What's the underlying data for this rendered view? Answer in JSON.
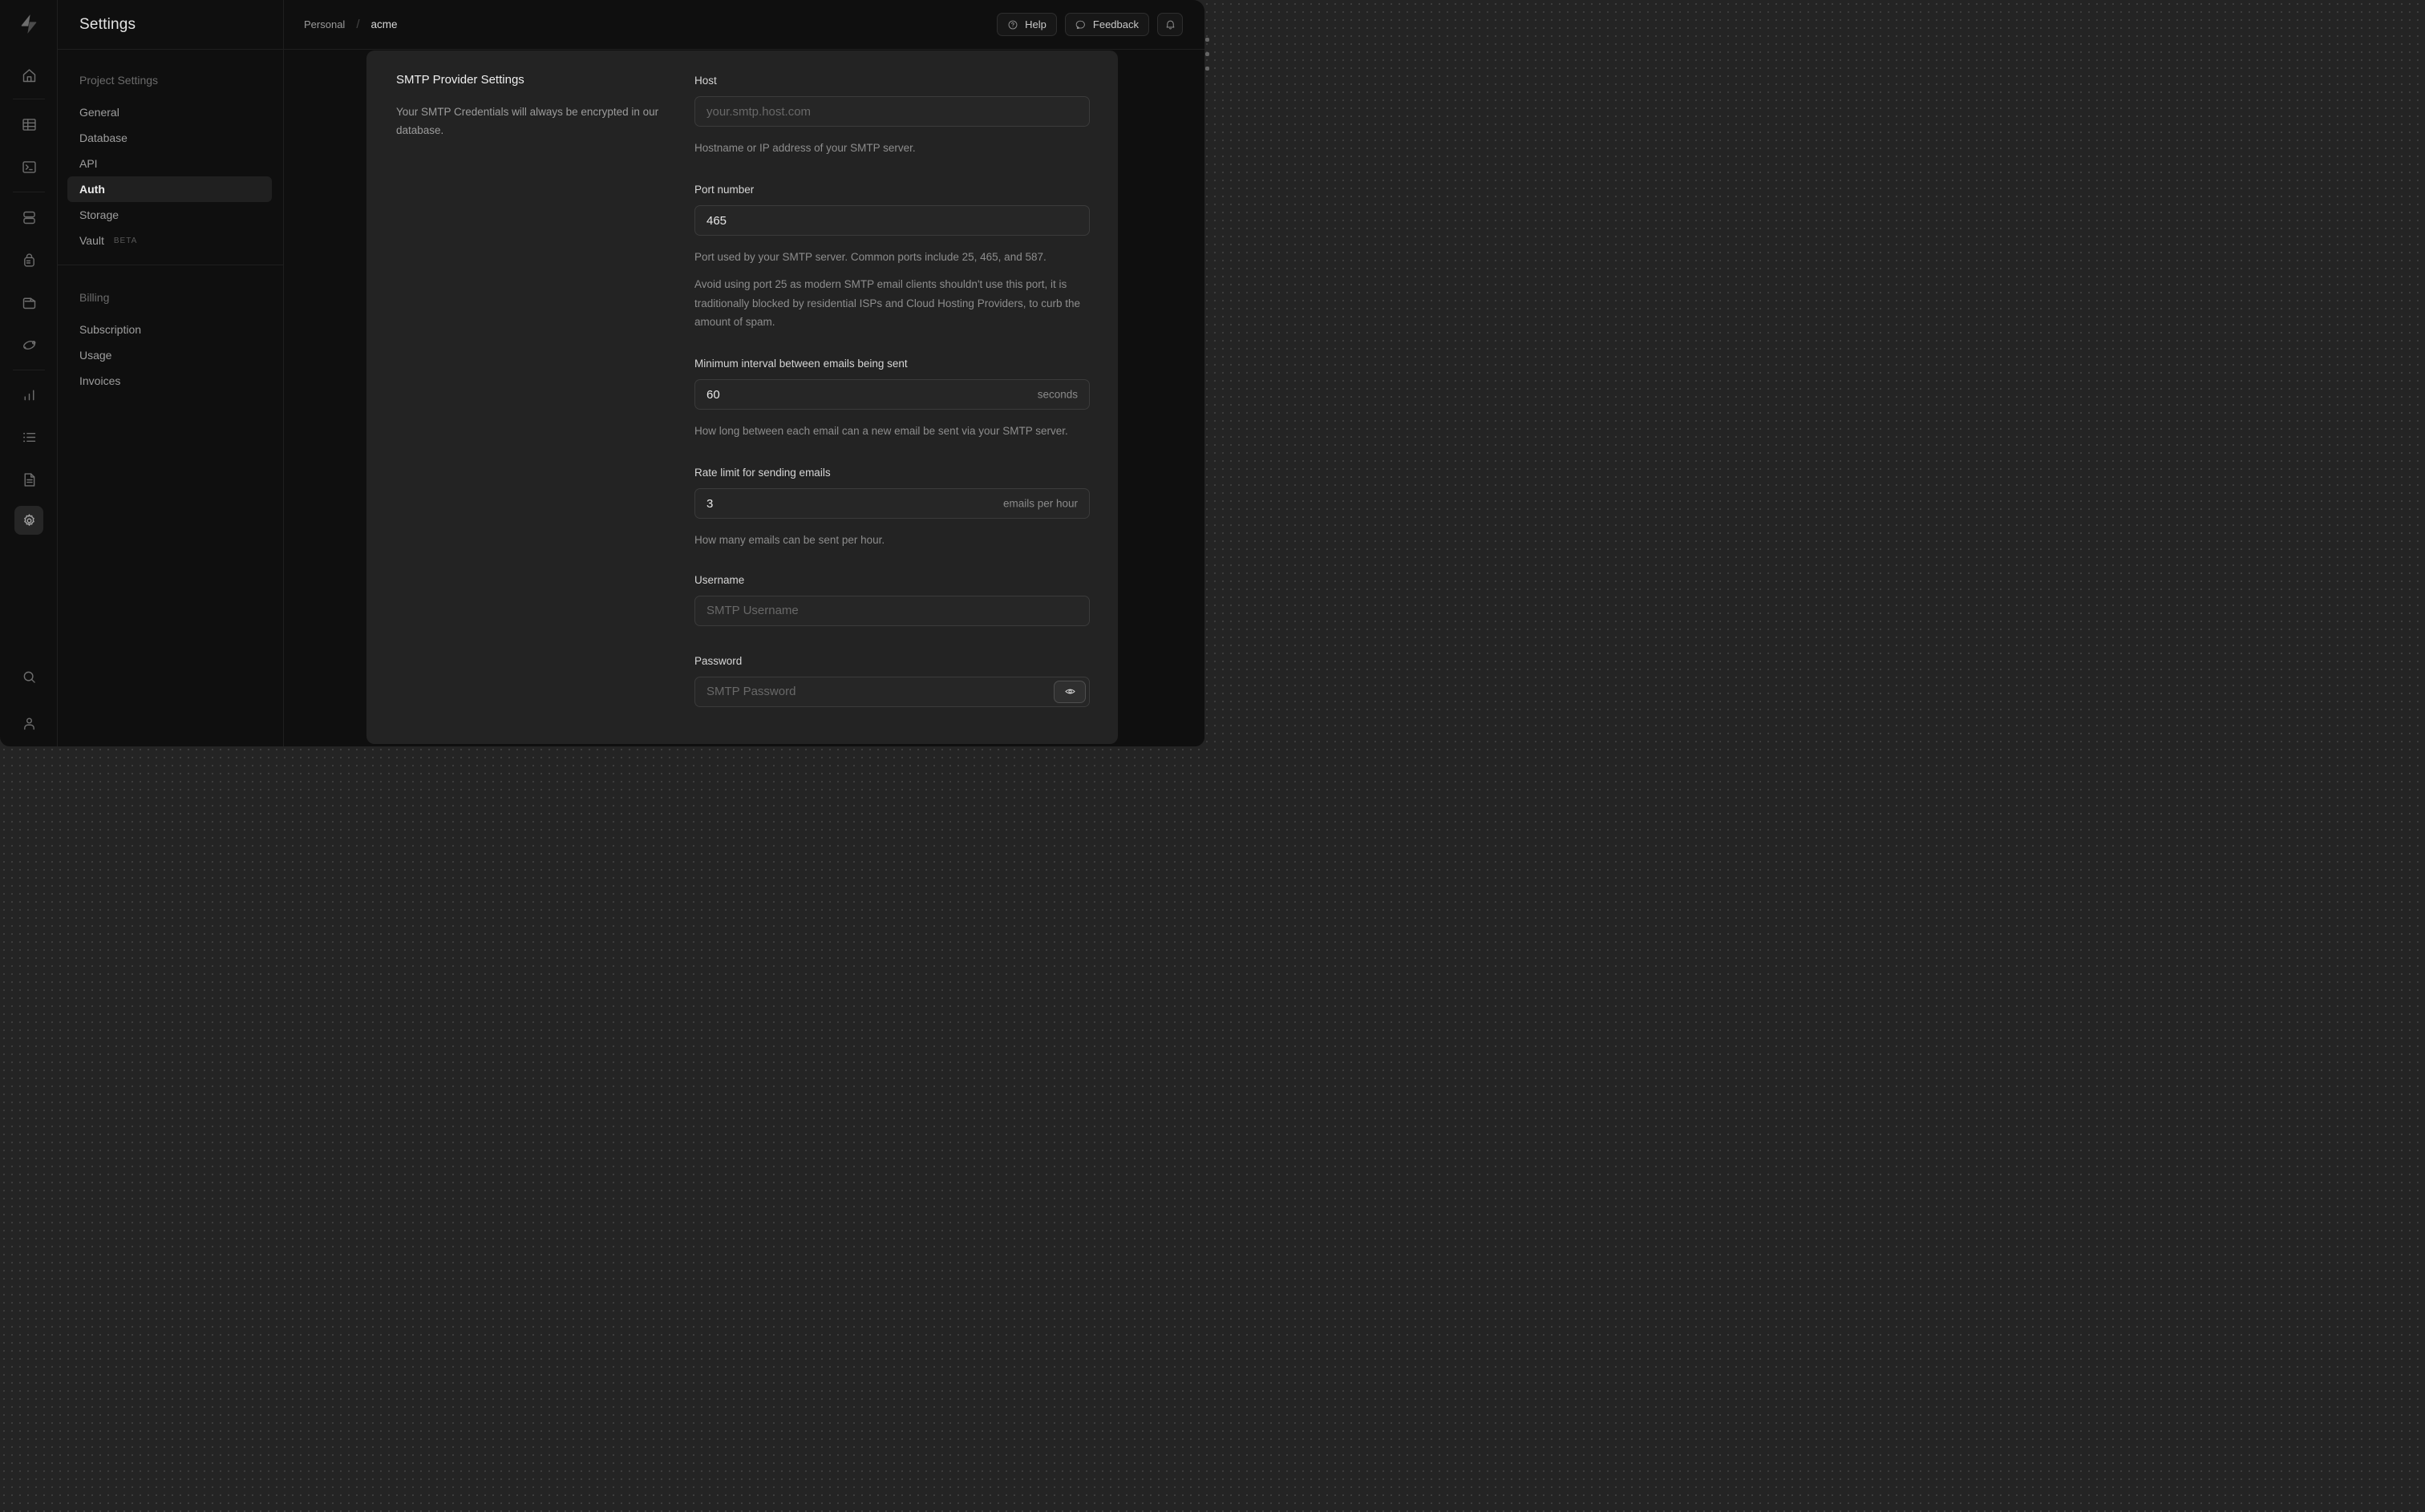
{
  "header": {
    "title": "Settings",
    "breadcrumb": {
      "org": "Personal",
      "separator": "/",
      "project": "acme"
    },
    "actions": {
      "help": "Help",
      "feedback": "Feedback",
      "notifications_icon": "bell-icon"
    }
  },
  "brand": {
    "logo_icon": "supabase-bolt-icon"
  },
  "rail": {
    "icons": [
      "home-icon",
      "table-editor-icon",
      "sql-editor-icon",
      "database-icon",
      "auth-lock-icon",
      "storage-folder-icon",
      "edge-functions-icon",
      "reports-chart-icon",
      "logs-list-icon",
      "docs-file-icon",
      "settings-gear-icon",
      "search-icon",
      "user-icon"
    ],
    "active": "settings-gear-icon"
  },
  "sidebar": {
    "sections": [
      {
        "heading": "Project Settings",
        "items": [
          {
            "label": "General"
          },
          {
            "label": "Database"
          },
          {
            "label": "API"
          },
          {
            "label": "Auth",
            "active": true
          },
          {
            "label": "Storage"
          },
          {
            "label": "Vault",
            "badge": "BETA"
          }
        ]
      },
      {
        "heading": "Billing",
        "items": [
          {
            "label": "Subscription"
          },
          {
            "label": "Usage"
          },
          {
            "label": "Invoices"
          }
        ]
      }
    ]
  },
  "main": {
    "section_title": "SMTP Provider Settings",
    "section_description": "Your SMTP Credentials will always be encrypted in our database.",
    "fields": {
      "host": {
        "label": "Host",
        "placeholder": "your.smtp.host.com",
        "help": "Hostname or IP address of your SMTP server."
      },
      "port": {
        "label": "Port number",
        "value": "465",
        "help": "Port used by your SMTP server. Common ports include 25, 465, and 587.",
        "note": "Avoid using port 25 as modern SMTP email clients shouldn't use this port, it is traditionally blocked by residential ISPs and Cloud Hosting Providers, to curb the amount of spam."
      },
      "interval": {
        "label": "Minimum interval between emails being sent",
        "value": "60",
        "suffix": "seconds",
        "help": "How long between each email can a new email be sent via your SMTP server."
      },
      "rate_limit": {
        "label": "Rate limit for sending emails",
        "value": "3",
        "suffix": "emails per hour",
        "help": "How many emails can be sent per hour."
      },
      "username": {
        "label": "Username",
        "placeholder": "SMTP Username"
      },
      "password": {
        "label": "Password",
        "placeholder": "SMTP Password",
        "reveal_icon": "eye-icon"
      }
    }
  },
  "colors": {
    "window_bg": "#0f0f0f",
    "panel_bg": "#232323",
    "input_bg": "#262626",
    "input_border": "#3b3b3b",
    "text_bright": "#e9e9e9",
    "text_muted": "#8d8d8d"
  }
}
